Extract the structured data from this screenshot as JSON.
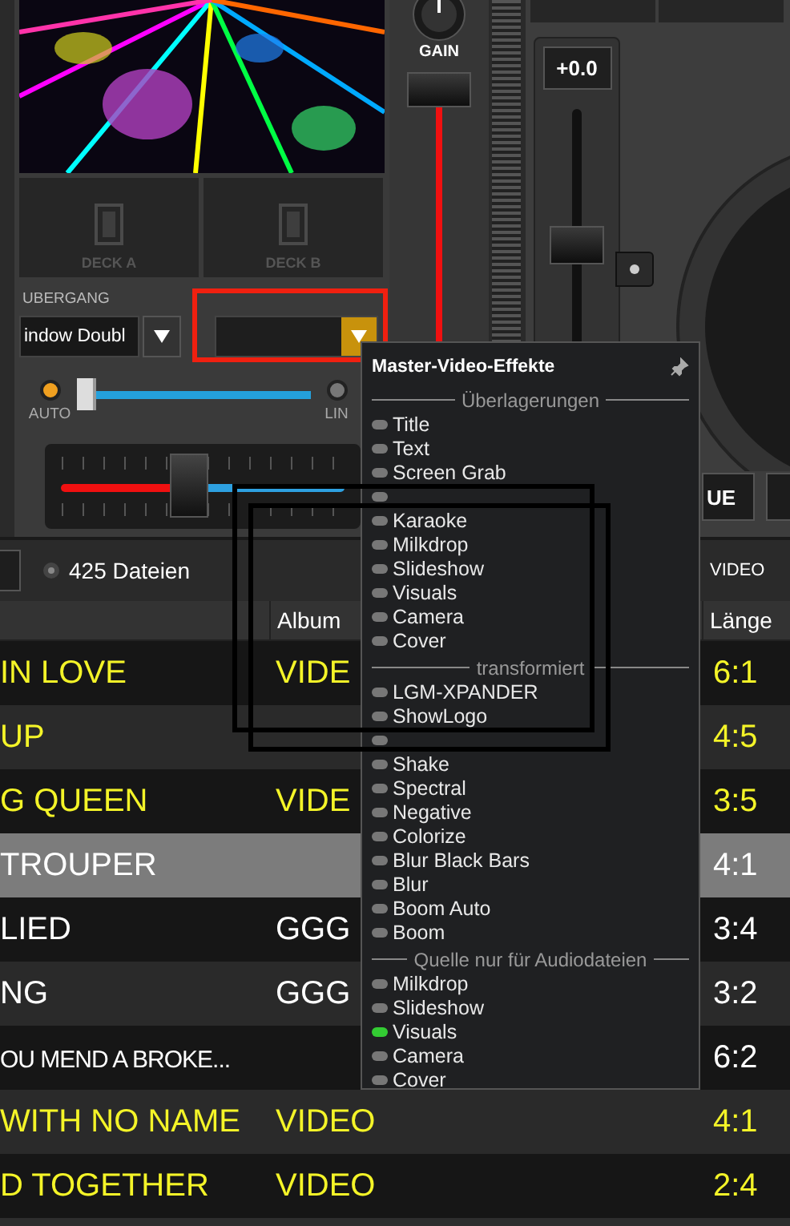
{
  "video_panel": {
    "decks": [
      {
        "label": "DECK A"
      },
      {
        "label": "DECK B"
      }
    ]
  },
  "transition": {
    "label": "UBERGANG",
    "value": "indow Doubl"
  },
  "auto_row": {
    "auto_label": "AUTO",
    "auto_on": true,
    "link_label": "LIN",
    "link_on": false,
    "level": 0
  },
  "crossfader": {
    "level": 0.45
  },
  "mixer": {
    "gain_label": "GAIN",
    "volume": {
      "level": 0.95
    }
  },
  "pitch": {
    "reading": "+0.0",
    "level": 0.5
  },
  "deck_buttons": [
    "UE"
  ],
  "browser": {
    "file_count": "425 Dateien",
    "path": "VIDEO",
    "columns": [
      "Album",
      "Länge"
    ],
    "rows": [
      {
        "title": "IN LOVE",
        "album": "VIDE",
        "length": "6:1",
        "kind": "video",
        "selected": false
      },
      {
        "title": "UP",
        "length": "4:5",
        "kind": "video",
        "selected": false
      },
      {
        "title": "G QUEEN",
        "album": "VIDE",
        "length": "3:5",
        "kind": "video",
        "selected": false
      },
      {
        "title": "TROUPER",
        "length": "4:1",
        "kind": "audio",
        "selected": true
      },
      {
        "title": "LIED",
        "album": "GGG",
        "length": "3:4",
        "kind": "audio",
        "selected": false
      },
      {
        "title": "NG",
        "album": "GGG",
        "length": "3:2",
        "kind": "audio",
        "selected": false
      },
      {
        "title": "OU MEND A BROKE...",
        "length": "6:2",
        "kind": "audio",
        "selected": false,
        "condensed": true
      },
      {
        "title": "WITH NO NAME",
        "album": "VIDEO",
        "length": "4:1",
        "kind": "video",
        "selected": false
      },
      {
        "title": "D TOGETHER",
        "album": "VIDEO",
        "length": "2:4",
        "kind": "video",
        "selected": false
      }
    ]
  },
  "menu": {
    "title": "Master-Video-Effekte",
    "sections": [
      {
        "heading": "Überlagerungen",
        "items": [
          {
            "label": "Title",
            "on": false
          },
          {
            "label": "Text",
            "on": false
          },
          {
            "label": "Screen Grab",
            "on": false
          },
          {
            "on": false
          },
          {
            "label": "Karaoke",
            "on": false
          },
          {
            "label": "Milkdrop",
            "on": false
          },
          {
            "label": "Slideshow",
            "on": false
          },
          {
            "label": "Visuals",
            "on": false
          },
          {
            "label": "Camera",
            "on": false
          },
          {
            "label": "Cover",
            "on": false
          }
        ]
      },
      {
        "heading": "transformiert",
        "items": [
          {
            "label": "LGM-XPANDER",
            "on": false
          },
          {
            "label": "ShowLogo",
            "on": false
          },
          {
            "on": false
          },
          {
            "label": "Shake",
            "on": false
          },
          {
            "label": "Spectral",
            "on": false
          },
          {
            "label": "Negative",
            "on": false
          },
          {
            "label": "Colorize",
            "on": false
          },
          {
            "label": "Blur Black Bars",
            "on": false
          },
          {
            "label": "Blur",
            "on": false
          },
          {
            "label": "Boom Auto",
            "on": false
          },
          {
            "label": "Boom",
            "on": false
          }
        ]
      },
      {
        "heading": "Quelle nur für Audiodateien",
        "items": [
          {
            "label": "Milkdrop",
            "on": false
          },
          {
            "label": "Slideshow",
            "on": false
          },
          {
            "label": "Visuals",
            "on": true
          },
          {
            "label": "Camera",
            "on": false
          },
          {
            "label": "Cover",
            "on": false
          }
        ]
      }
    ]
  }
}
